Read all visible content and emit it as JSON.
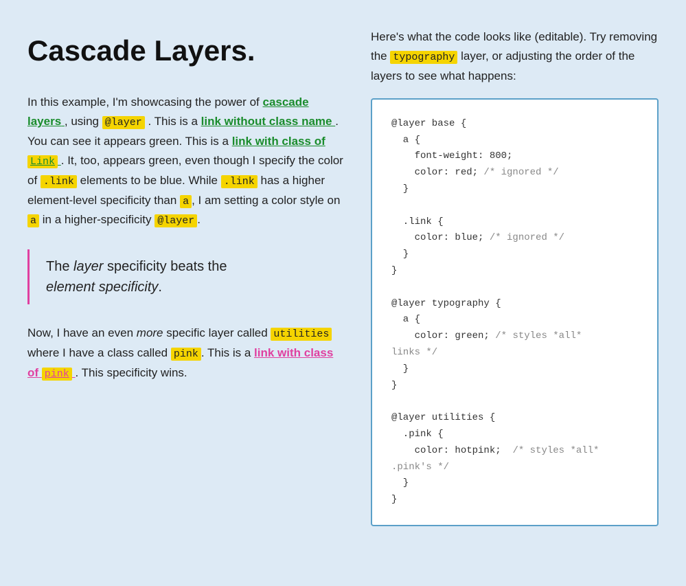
{
  "page": {
    "title": "Cascade Layers.",
    "bg_color": "#ddeaf5"
  },
  "left": {
    "intro": "In this example, I'm showcasing the power of",
    "cascade_layers_link": "cascade layers",
    "using_text": ", using",
    "layer_code": "@layer",
    "after_layer": ". This is a",
    "link_no_class": "link without class name",
    "after_link_no_class": ". You can see it appears green. This is a",
    "link_with_class": "link with class of",
    "link_class_code": "Link",
    "after_link": ". It, too, appears green, even though I specify the color of",
    "link_code_1": ".link",
    "middle_text": "elements to be blue. While",
    "link_code_2": ".link",
    "has_higher": "has a higher element-level specificity than",
    "a_code": "a",
    "comma_text": ", I am setting a color style on",
    "a_code_2": "a",
    "in_higher": "in a higher-specificity",
    "layer_code_2": "@layer",
    "period": ".",
    "blockquote_line1": "The",
    "blockquote_italic1": "layer",
    "blockquote_line1b": "specificity beats the",
    "blockquote_italic2": "element specificity",
    "blockquote_period": ".",
    "now_text": "Now, I have an even",
    "more_italic": "more",
    "specific_text": "specific layer called",
    "utilities_code": "utilities",
    "where_text": "where I have a class called",
    "pink_code": "pink",
    "this_is_a": ". This is a",
    "link_pink_text": "link with class of",
    "pink_highlight": "pink",
    "this_specificity": ". This specificity wins."
  },
  "right": {
    "desc_part1": "Here's what the code looks like (editable). Try removing the",
    "typography_highlight": "typography",
    "desc_part2": "layer, or adjusting the order of the layers to see what happens:",
    "code": "@layer base {\n  a {\n    font-weight: 800;\n    color: red; /* ignored */\n  }\n\n  .link {\n    color: blue; /* ignored */\n  }\n}\n\n@layer typography {\n  a {\n    color: green; /* styles *all*\nlinks */\n  }\n}\n\n@layer utilities {\n  .pink {\n    color: hotpink;  /* styles *all*\n.pink's */\n  }\n}"
  }
}
